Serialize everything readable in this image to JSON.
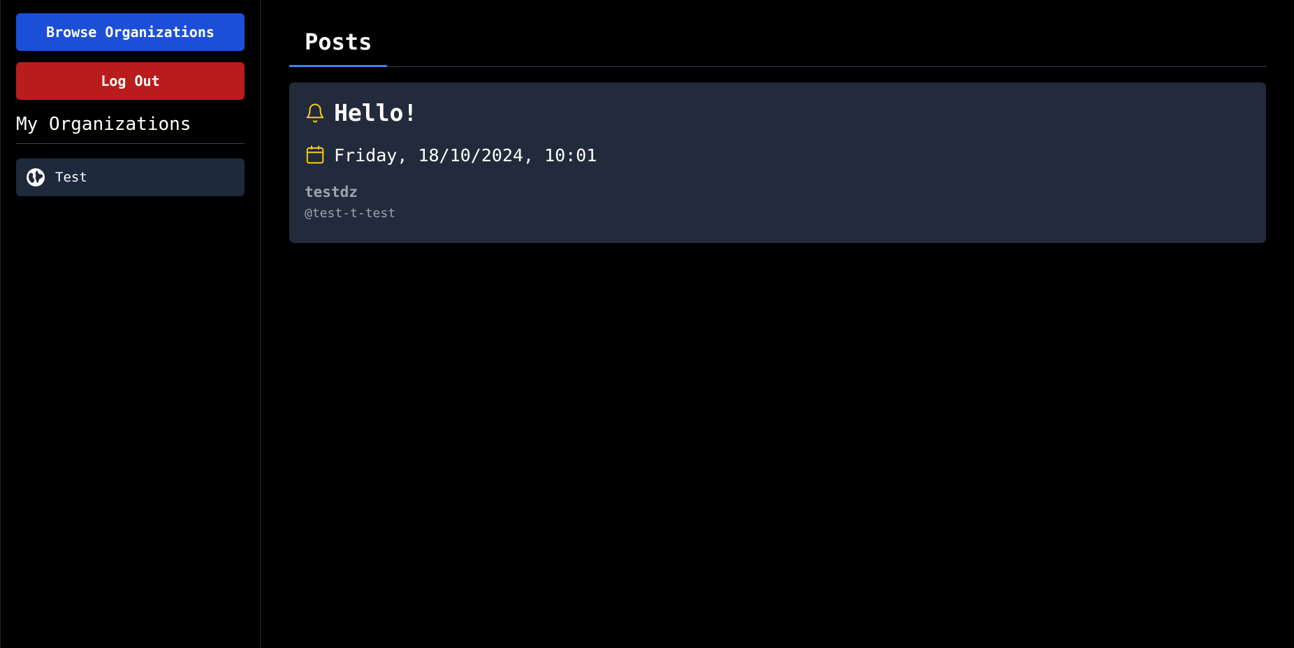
{
  "sidebar": {
    "browse_label": "Browse Organizations",
    "logout_label": "Log Out",
    "section_title": "My Organizations",
    "organizations": [
      {
        "label": "Test",
        "icon": "globe-icon"
      }
    ]
  },
  "main": {
    "tabs": [
      {
        "label": "Posts"
      }
    ],
    "posts": [
      {
        "title": "Hello!",
        "title_icon": "bell-icon",
        "date": "Friday, 18/10/2024, 10:01",
        "date_icon": "calendar-icon",
        "author": "testdz",
        "handle": "@test-t-test"
      }
    ]
  },
  "colors": {
    "primary": "#1d4ed8",
    "danger": "#b91c1c",
    "card": "#212b3b",
    "icon_accent": "#facc15",
    "tab_underline": "#3b82f6"
  }
}
